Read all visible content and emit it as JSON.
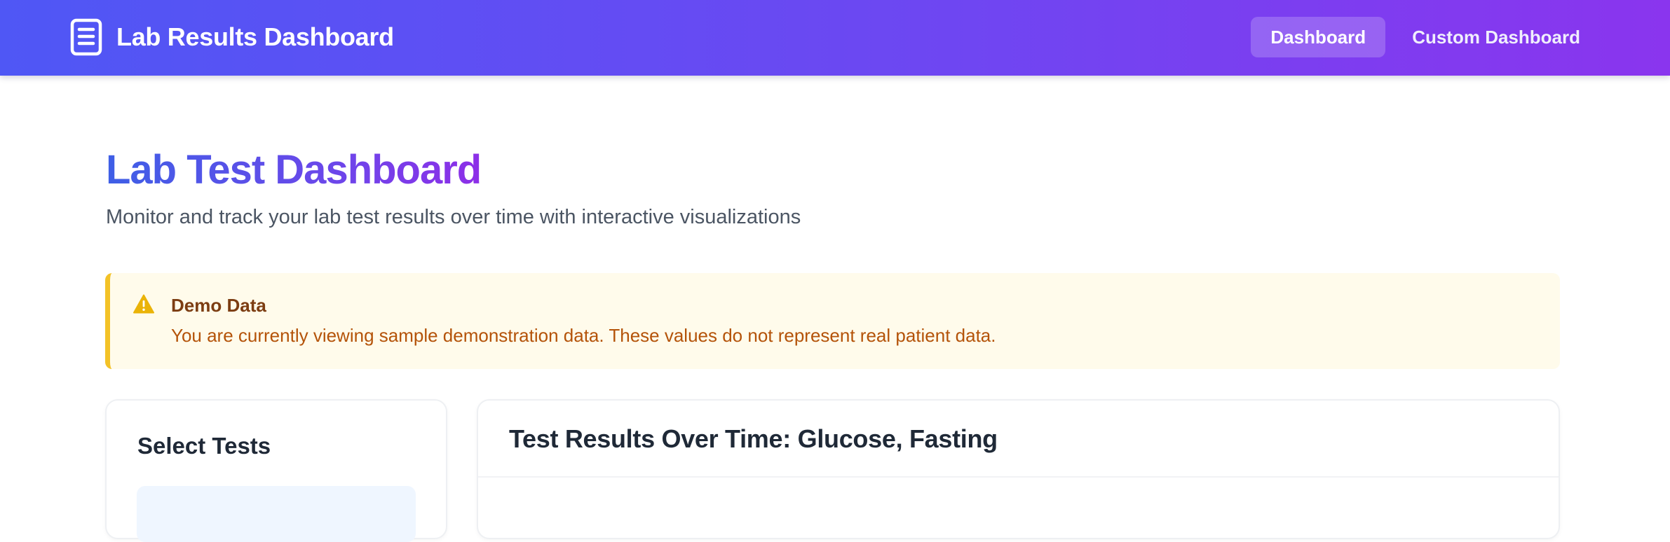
{
  "header": {
    "app_title": "Lab Results Dashboard",
    "nav": [
      {
        "label": "Dashboard",
        "active": true
      },
      {
        "label": "Custom Dashboard",
        "active": false
      }
    ]
  },
  "main": {
    "title": "Lab Test Dashboard",
    "subtitle": "Monitor and track your lab test results over time with interactive visualizations"
  },
  "alert": {
    "icon": "warning-icon",
    "title": "Demo Data",
    "message": "You are currently viewing sample demonstration data. These values do not represent real patient data."
  },
  "select_panel": {
    "heading": "Select Tests"
  },
  "chart_panel": {
    "heading": "Test Results Over Time: Glucose, Fasting"
  },
  "colors": {
    "header_gradient_start": "#4f57f5",
    "header_gradient_end": "#8a35ee",
    "alert_border": "#f3c227",
    "alert_background": "#fffbeb"
  }
}
